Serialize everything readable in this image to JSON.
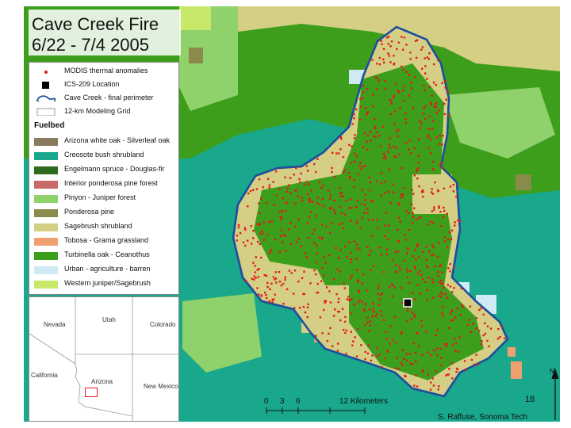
{
  "title": {
    "line1": "Cave Creek Fire",
    "line2": "6/22 - 7/4 2005"
  },
  "legend": {
    "items": [
      {
        "label": "MODIS thermal anomalies",
        "symbol": "dot",
        "color": "#e31a1c"
      },
      {
        "label": "ICS-209 Location",
        "symbol": "square",
        "color": "#000000"
      },
      {
        "label": "Cave Creek - final perimeter",
        "symbol": "outline",
        "color": "#1f4e9c"
      },
      {
        "label": "12-km Modeling Grid",
        "symbol": "grid",
        "color": "#cccccc"
      }
    ],
    "fuelbed_heading": "Fuelbed",
    "fuelbeds": [
      {
        "label": "Arizona white oak - Silverleaf oak",
        "color": "#8b7b5e"
      },
      {
        "label": "Creosote bush shrubland",
        "color": "#19a88c"
      },
      {
        "label": "Engelmann spruce - Douglas-fir",
        "color": "#2e6b1e"
      },
      {
        "label": "Interior ponderosa pine forest",
        "color": "#c96a6a"
      },
      {
        "label": "Pinyon - Juniper forest",
        "color": "#8fd16b"
      },
      {
        "label": "Ponderosa pine",
        "color": "#8a8a4a"
      },
      {
        "label": "Sagebrush shrubland",
        "color": "#d4cf84"
      },
      {
        "label": "Tobosa - Grama grassland",
        "color": "#f0a070"
      },
      {
        "label": "Turbinella oak - Ceanothus",
        "color": "#3d9e1c"
      },
      {
        "label": "Urban - agriculture - barren",
        "color": "#cdeaf5"
      },
      {
        "label": "Western juniper/Sagebrush",
        "color": "#c8e86a"
      }
    ]
  },
  "inset_map": {
    "states": [
      "Nevada",
      "Utah",
      "Colorado",
      "California",
      "Arizona",
      "New Mexico"
    ],
    "locator_color": "#e31a1c"
  },
  "scale_bar": {
    "ticks": [
      "0",
      "3",
      "6",
      "12 Kilometers"
    ]
  },
  "credit": "S. Raffuse,  Sonoma Tech",
  "slide_number": "18",
  "north_arrow_label": "N"
}
